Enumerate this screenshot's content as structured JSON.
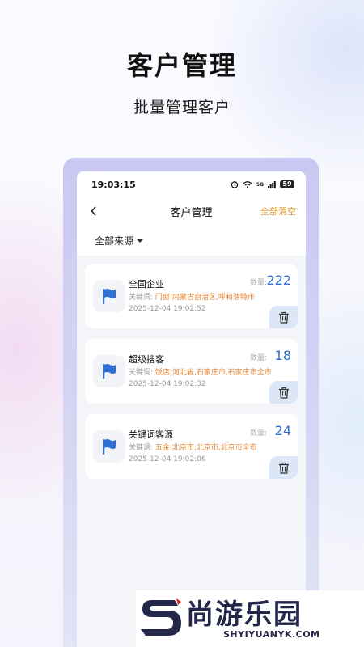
{
  "promo": {
    "title": "客户管理",
    "subtitle": "批量管理客户"
  },
  "statusbar": {
    "time": "19:03:15",
    "network_label": "5G",
    "battery": "59"
  },
  "navbar": {
    "title": "客户管理",
    "clear_all": "全部清空"
  },
  "filter": {
    "selected": "全部来源"
  },
  "cards": [
    {
      "title": "全国企业",
      "count_label": "数量:",
      "count": "222",
      "keyword_label": "关键词:",
      "keywords": "门窗|内蒙古自治区,呼和浩特市",
      "date": "2025-12-04 19:02:52"
    },
    {
      "title": "超级搜客",
      "count_label": "数量:",
      "count": "18",
      "keyword_label": "关键词:",
      "keywords": "饭店|河北省,石家庄市,石家庄市全市",
      "date": "2025-12-04 19:02:32"
    },
    {
      "title": "关键词客源",
      "count_label": "数量:",
      "count": "24",
      "keyword_label": "关键词:",
      "keywords": "五金|北京市,北京市,北京市全市",
      "date": "2025-12-04 19:02:06"
    }
  ],
  "watermark": {
    "brand": "尚游乐园",
    "url": "SHYIYUANYK.COM"
  },
  "colors": {
    "accent_blue": "#2f6fd6",
    "accent_orange": "#e39a2b",
    "delete_bg": "#dbe6f7"
  }
}
